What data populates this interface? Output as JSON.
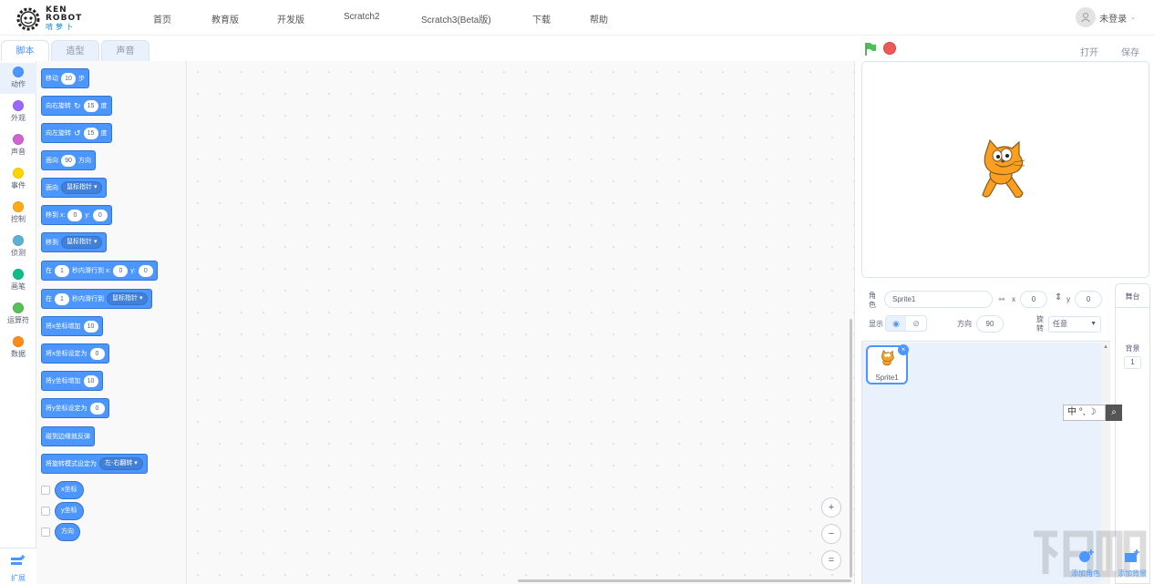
{
  "brand": {
    "line1": "KEN",
    "line2": "ROBOT",
    "line3": "啃萝卜"
  },
  "nav": [
    "首页",
    "教育版",
    "开发版",
    "Scratch2",
    "Scratch3(Beta版)",
    "下载",
    "帮助"
  ],
  "user": {
    "label": "未登录"
  },
  "tabs": [
    "脚本",
    "造型",
    "声音"
  ],
  "categories": [
    {
      "label": "动作",
      "color": "#4c97ff"
    },
    {
      "label": "外观",
      "color": "#9966ff"
    },
    {
      "label": "声音",
      "color": "#cf63cf"
    },
    {
      "label": "事件",
      "color": "#ffd500"
    },
    {
      "label": "控制",
      "color": "#ffab19"
    },
    {
      "label": "侦测",
      "color": "#5cb1d6"
    },
    {
      "label": "画笔",
      "color": "#0fbd8c"
    },
    {
      "label": "运算符",
      "color": "#59c059"
    },
    {
      "label": "数据",
      "color": "#ff8c1a"
    }
  ],
  "extension": {
    "label": "扩展"
  },
  "blocks": {
    "move": {
      "a": "移动",
      "v": "10",
      "b": "步"
    },
    "turn_right": {
      "a": "向右旋转",
      "v": "15",
      "b": "度"
    },
    "turn_left": {
      "a": "向左旋转",
      "v": "15",
      "b": "度"
    },
    "point_dir": {
      "a": "面向",
      "v": "90",
      "b": "方向"
    },
    "point_to": {
      "a": "面向",
      "d": "鼠标指针"
    },
    "goto_xy": {
      "a": "移到 x:",
      "x": "0",
      "b": "y:",
      "y": "0"
    },
    "goto": {
      "a": "移到",
      "d": "鼠标指针"
    },
    "glide_xy": {
      "a": "在",
      "v": "1",
      "b": "秒内滑行到 x:",
      "x": "0",
      "c": "y:",
      "y": "0"
    },
    "glide_to": {
      "a": "在",
      "v": "1",
      "b": "秒内滑行到",
      "d": "鼠标指针"
    },
    "change_x": {
      "a": "将x坐标增加",
      "v": "10"
    },
    "set_x": {
      "a": "将x坐标设定为",
      "v": "0"
    },
    "change_y": {
      "a": "将y坐标增加",
      "v": "10"
    },
    "set_y": {
      "a": "将y坐标设定为",
      "v": "0"
    },
    "bounce": {
      "a": "碰到边缘就反弹"
    },
    "rotation": {
      "a": "将旋转模式设定为",
      "d": "左-右翻转"
    },
    "xpos": "x坐标",
    "ypos": "y坐标",
    "direction": "方向"
  },
  "zoom": {
    "in": "+",
    "out": "−",
    "reset": "="
  },
  "stage_header": {
    "open": "打开",
    "save": "保存"
  },
  "sprite_info": {
    "role_label": "角色",
    "name": "Sprite1",
    "x_label": "x",
    "x": "0",
    "y_label": "y",
    "y": "0",
    "show_label": "显示",
    "direction_label": "方向",
    "direction": "90",
    "rotate_label": "旋转",
    "rotate_value": "任意"
  },
  "sprite_list": [
    {
      "name": "Sprite1"
    }
  ],
  "stage_panel": {
    "title": "舞台",
    "backdrop_label": "背景",
    "backdrop_count": "1"
  },
  "ime": {
    "text": "中 °, ☽"
  },
  "add_buttons": {
    "sprite": "添加角色",
    "backdrop": "添加背景"
  },
  "colors": {
    "accent": "#4c97ff",
    "motion": "#4c97ff",
    "flag": "#4cbf56",
    "stop": "#ec5959"
  }
}
